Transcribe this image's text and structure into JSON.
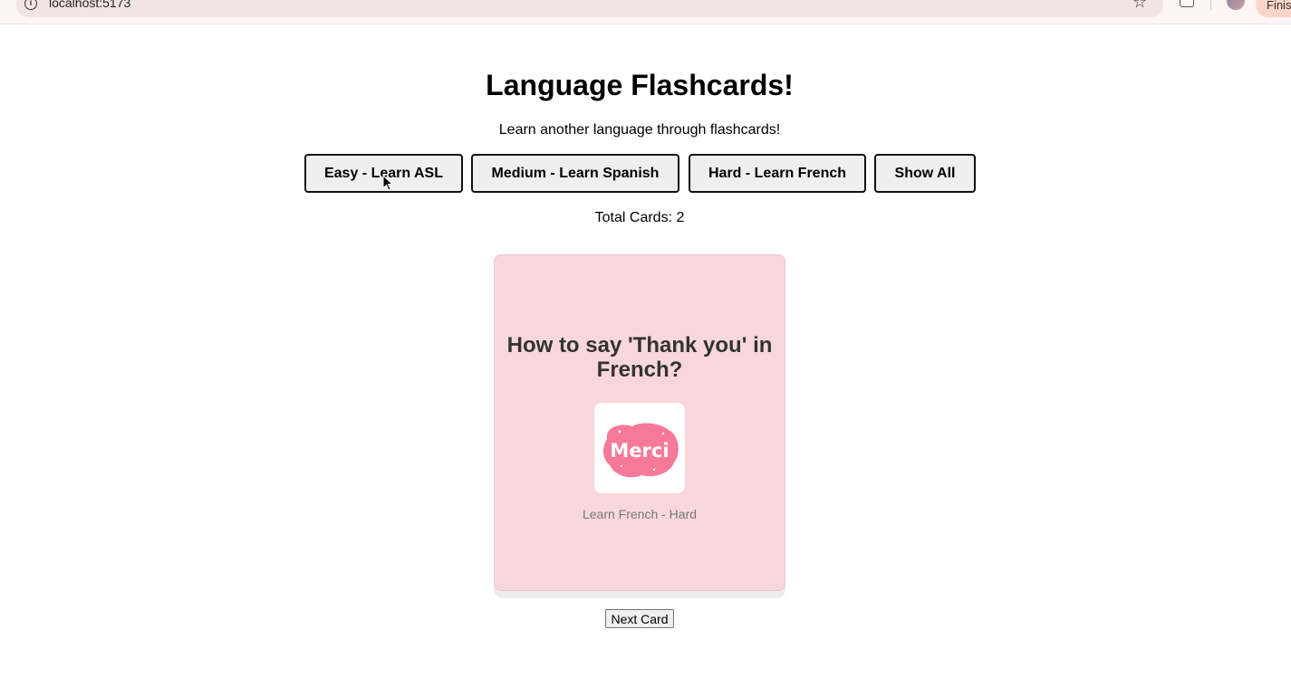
{
  "browser": {
    "url": "localhost:5173",
    "profile_button_label": "Finis"
  },
  "app": {
    "title": "Language Flashcards!",
    "subtitle": "Learn another language through flashcards!",
    "buttons": [
      {
        "label": "Easy - Learn ASL"
      },
      {
        "label": "Medium - Learn Spanish"
      },
      {
        "label": "Hard - Learn French"
      },
      {
        "label": "Show All"
      }
    ],
    "total_cards": "Total Cards: 2"
  },
  "card": {
    "question": "How to say 'Thank you' in French?",
    "image_text": "Merci",
    "label": "Learn French - Hard"
  },
  "next_button": "Next Card",
  "colors": {
    "card_bg": "#f8d7dc",
    "button_bg": "#efefef",
    "image_blob": "#f7799a"
  }
}
